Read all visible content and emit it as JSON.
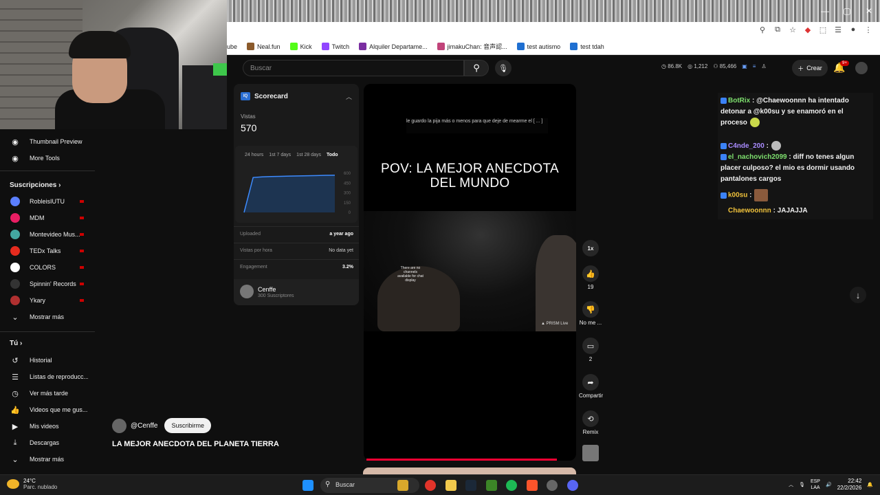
{
  "bookmarks": [
    {
      "label": "ube",
      "color": "#ff0000"
    },
    {
      "label": "Neal.fun",
      "color": "#8b5a2b"
    },
    {
      "label": "Kick",
      "color": "#53fc18"
    },
    {
      "label": "Twitch",
      "color": "#9146ff"
    },
    {
      "label": "Alquiler Departame...",
      "color": "#7a2ea1"
    },
    {
      "label": "jimakuChan: 音声認...",
      "color": "#c1447a"
    },
    {
      "label": "test autismo",
      "color": "#1f6fd1"
    },
    {
      "label": "test tdah",
      "color": "#1f6fd1"
    }
  ],
  "header": {
    "search_placeholder": "Buscar",
    "stats": [
      "86.8K",
      "1,212",
      "85,466"
    ],
    "create_label": "Crear",
    "notif_badge": "9+"
  },
  "sidebar": {
    "top_items": [
      {
        "label": "Thumbnail Preview",
        "icon": "thumbnail-preview-icon"
      },
      {
        "label": "More Tools",
        "icon": "more-tools-icon"
      }
    ],
    "subs_title": "Suscripciones",
    "subscriptions": [
      {
        "label": "RobleisIUTU",
        "color": "#5b7fff"
      },
      {
        "label": "MDM",
        "color": "#e91e63"
      },
      {
        "label": "Montevideo Mus...",
        "color": "#43a7a0"
      },
      {
        "label": "TEDx Talks",
        "color": "#e62b1e"
      },
      {
        "label": "COLORS",
        "color": "#ffffff"
      },
      {
        "label": "Spinnin' Records",
        "color": "#333333"
      },
      {
        "label": "Ykary",
        "color": "#b03030"
      }
    ],
    "show_more_1": "Mostrar más",
    "you_title": "Tú",
    "you_items": [
      {
        "label": "Historial",
        "icon": "history-icon"
      },
      {
        "label": "Listas de reproducc...",
        "icon": "playlists-icon"
      },
      {
        "label": "Ver más tarde",
        "icon": "watch-later-icon"
      },
      {
        "label": "Videos que me gus...",
        "icon": "liked-videos-icon"
      },
      {
        "label": "Mis videos",
        "icon": "my-videos-icon"
      },
      {
        "label": "Descargas",
        "icon": "downloads-icon"
      }
    ],
    "show_more_2": "Mostrar más"
  },
  "scorecard": {
    "title": "Scorecard",
    "views_label": "Vistas",
    "views_value": "570",
    "periods": [
      "24 hours",
      "1st 7 days",
      "1st 28 days",
      "Todo"
    ],
    "selected_period": "Todo",
    "y_ticks": [
      "600",
      "450",
      "300",
      "150",
      "0"
    ],
    "rows": [
      {
        "label": "Uploaded",
        "value": "a year ago"
      },
      {
        "label": "Vistas por hora",
        "value": "No data yet"
      },
      {
        "label": "Engagement",
        "value": "3.2%"
      }
    ],
    "channel_name": "Cenffe",
    "channel_subs": "300 Suscriptores"
  },
  "chart_data": {
    "type": "line",
    "title": "",
    "xlabel": "",
    "ylabel": "",
    "ylim": [
      0,
      600
    ],
    "x": [
      0,
      1,
      2,
      3,
      4,
      5,
      6,
      7,
      8,
      9,
      10
    ],
    "series": [
      {
        "values": [
          0,
          535,
          545,
          550,
          553,
          556,
          559,
          562,
          565,
          568,
          570
        ]
      }
    ],
    "grid": false,
    "legend": "none"
  },
  "video": {
    "caption": "le guardo la pija más o menos para que deje de mearme el [ ... ]",
    "title_line1": "POV: LA MEJOR ANECDOTA",
    "title_line2": "DEL MUNDO",
    "no_chat": "There are no channels available for chat display",
    "prism": "▲ PRISM Live",
    "progress": 0.9
  },
  "actions": {
    "speed": "1x",
    "likes": "19",
    "dislike": "No me ...",
    "comments": "2",
    "share": "Compartir",
    "remix": "Remix"
  },
  "chat": [
    {
      "user": "BotRix",
      "user_color": "#7ee06e",
      "text": ": @Chaewoonnn ha intentado detonar a @k00su y se enamoró en el proceso"
    },
    {
      "user": "C4nde_200",
      "user_color": "#a98bff",
      "text": ":"
    },
    {
      "user": "el_nachovich2099",
      "user_color": "#7ee06e",
      "text": ": diff no tenes algun placer culposo? el mio es dormir usando pantalones cargos"
    },
    {
      "user": "k00su",
      "user_color": "#f0c23b",
      "text": ":"
    },
    {
      "user": "Chaewoonnn",
      "user_color": "#f0c23b",
      "text": ": JAJAJJA"
    }
  ],
  "owner": {
    "handle": "@Cenffe",
    "subscribe_label": "Suscribirme",
    "video_title": "LA MEJOR ANECDOTA DEL PLANETA TIERRA"
  },
  "taskbar": {
    "temperature": "24°C",
    "weather": "Parc. nublado",
    "search": "Buscar",
    "lang1": "ESP",
    "lang2": "LAA",
    "time": "22:42",
    "date": "22/2/2026"
  }
}
